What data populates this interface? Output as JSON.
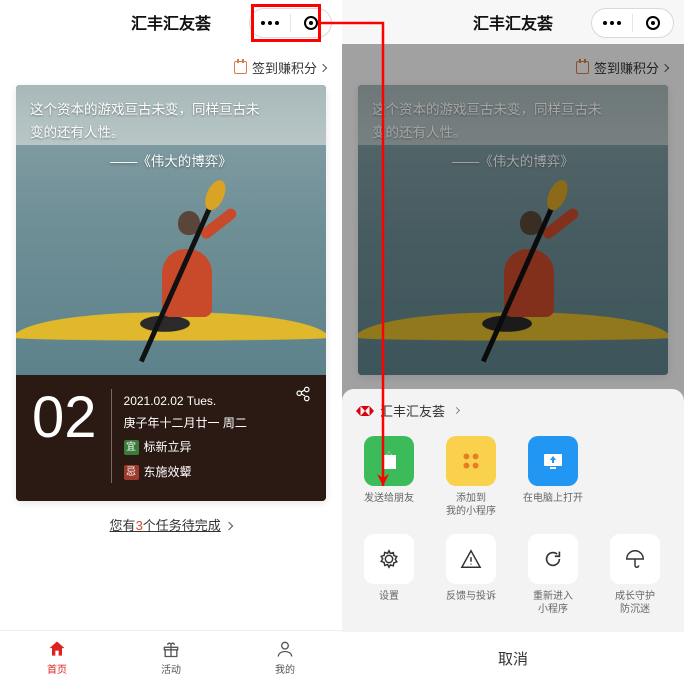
{
  "left": {
    "title": "汇丰汇友荟",
    "signin": "签到赚积分",
    "quote_line1": "这个资本的游戏亘古未变，同样亘古未",
    "quote_line2": "变的还有人性。",
    "quote_source": "——《伟大的博弈》",
    "day": "02",
    "date_full": "2021.02.02 Tues.",
    "lunar": "庚子年十二月廿一 周二",
    "yi_label": "宜",
    "yi_text": "标新立异",
    "ji_label": "忌",
    "ji_text": "东施效颦",
    "task_prefix": "您有",
    "task_count": "3",
    "task_suffix": "个任务待完成",
    "tabs": {
      "home": "首页",
      "activity": "活动",
      "mine": "我的"
    }
  },
  "right": {
    "title": "汇丰汇友荟",
    "signin": "签到赚积分",
    "quote_line1": "这个资本的游戏亘古未变，同样亘古未",
    "quote_line2": "变的还有人性。",
    "quote_source": "——《伟大的博弈》",
    "sheet_title": "汇丰汇友荟",
    "actions": {
      "send": "发送给朋友",
      "add": "添加到\n我的小程序",
      "pc": "在电脑上打开",
      "settings": "设置",
      "feedback": "反馈与投诉",
      "restart": "重新进入\n小程序",
      "guard": "成长守护\n防沉迷"
    },
    "cancel": "取消"
  }
}
